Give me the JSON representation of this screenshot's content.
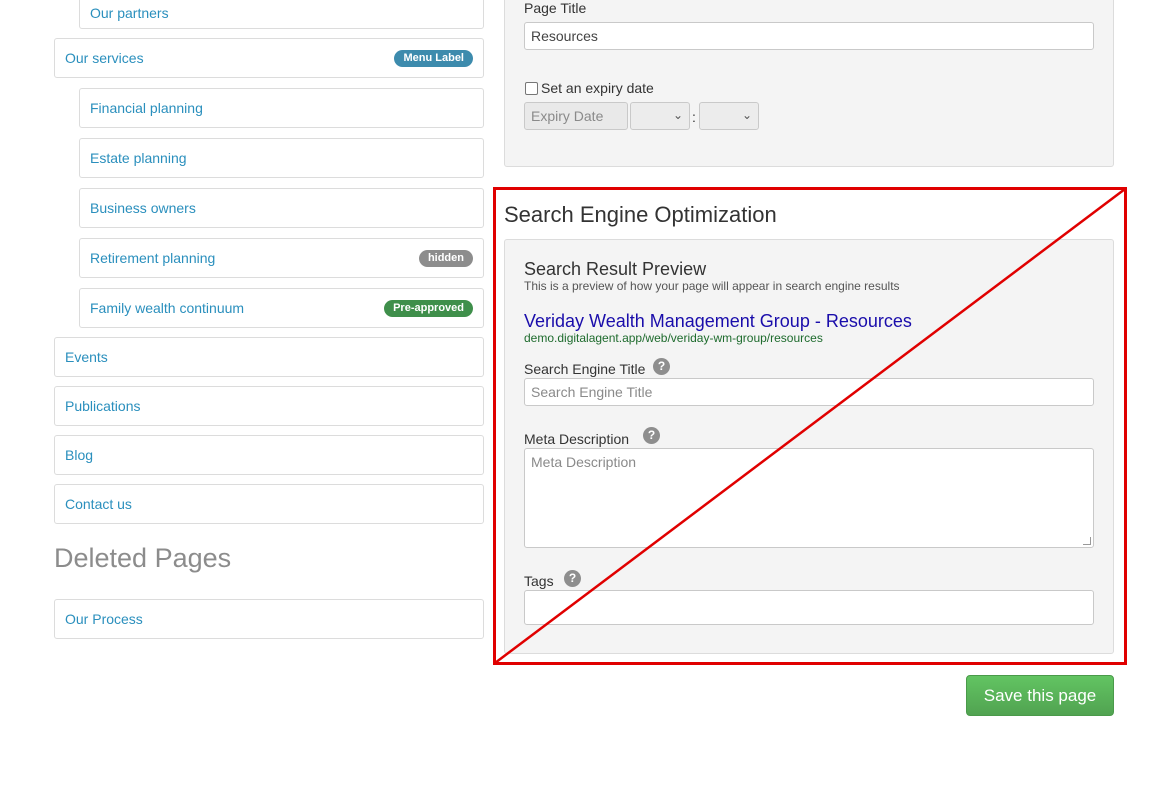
{
  "page_tree": {
    "items": [
      {
        "label": "Our partners"
      },
      {
        "label": "Our services",
        "badge": "Menu Label"
      },
      {
        "label": "Financial planning"
      },
      {
        "label": "Estate planning"
      },
      {
        "label": "Business owners"
      },
      {
        "label": "Retirement planning",
        "badge": "hidden"
      },
      {
        "label": "Family wealth continuum",
        "badge": "Pre-approved"
      },
      {
        "label": "Events"
      },
      {
        "label": "Publications"
      },
      {
        "label": "Blog"
      },
      {
        "label": "Contact us"
      }
    ],
    "deleted_heading": "Deleted Pages",
    "deleted_items": [
      {
        "label": "Our Process"
      }
    ]
  },
  "page_settings": {
    "page_title_label": "Page Title",
    "page_title_value": "Resources",
    "expiry_checkbox_label": "Set an expiry date",
    "expiry_checked": false,
    "expiry_date_placeholder": "Expiry Date",
    "time_separator": ":"
  },
  "seo": {
    "heading": "Search Engine Optimization",
    "preview_heading": "Search Result Preview",
    "preview_description": "This is a preview of how your page will appear in search engine results",
    "preview_title": "Veriday Wealth Management Group - Resources",
    "preview_url": "demo.digitalagent.app/web/veriday-wm-group/resources",
    "search_title_label": "Search Engine Title",
    "search_title_placeholder": "Search Engine Title",
    "meta_description_label": "Meta Description",
    "meta_description_placeholder": "Meta Description",
    "tags_label": "Tags",
    "help_glyph": "?"
  },
  "actions": {
    "save_label": "Save this page"
  },
  "colors": {
    "link": "#2a8fbd",
    "serp_title": "#1a0dab",
    "serp_url": "#1e6b2d",
    "save_button": "#5cb85c",
    "highlight": "#e00000"
  }
}
